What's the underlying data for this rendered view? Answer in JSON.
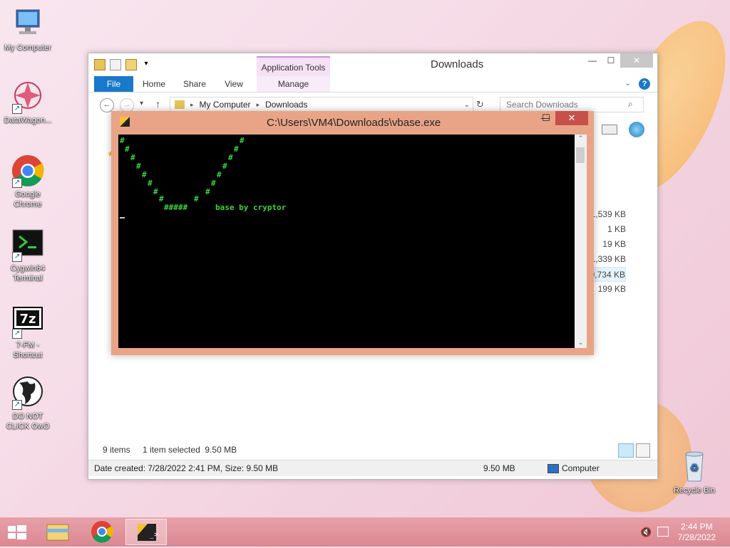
{
  "desktop": {
    "icons": [
      {
        "label": "My Computer"
      },
      {
        "label": "DataWagon..."
      },
      {
        "label": "Google Chrome"
      },
      {
        "label": "Cygwin64 Terminal"
      },
      {
        "label": "7-FM - Shortcut"
      },
      {
        "label": "DO NOT CLICK OwO"
      },
      {
        "label": "Recycle Bin"
      }
    ]
  },
  "explorer": {
    "title": "Downloads",
    "context_tab": "Application Tools",
    "tabs": [
      "File",
      "Home",
      "Share",
      "View",
      "Manage"
    ],
    "address": [
      "My Computer",
      "Downloads"
    ],
    "search_placeholder": "Search Downloads",
    "sizes": [
      "1,539 KB",
      "1 KB",
      "19 KB",
      "1,339 KB",
      "9,734 KB",
      "199 KB"
    ],
    "status": {
      "items": "9 items",
      "selected": "1 item selected  9.50 MB",
      "details": "Date created: 7/28/2022 2:41 PM, Size: 9.50 MB",
      "size": "9.50 MB",
      "location": "Computer"
    }
  },
  "console": {
    "title": "C:\\Users\\VM4\\Downloads\\vbase.exe",
    "text": "base by cryptor",
    "art_char": "#",
    "art_bottom": "#####"
  },
  "taskbar": {
    "time": "2:44 PM",
    "date": "7/28/2022"
  },
  "colors": {
    "console_frame": "#e9a487",
    "console_text": "#37d63a",
    "taskbar": "#dc8892",
    "file_tab": "#1979ca"
  }
}
